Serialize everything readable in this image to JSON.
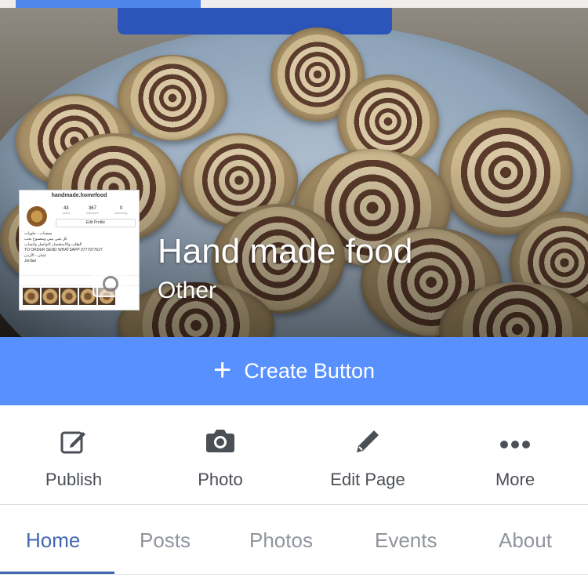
{
  "profile_card": {
    "username": "handmade.homefood",
    "stats": [
      {
        "value": "43",
        "label": "posts"
      },
      {
        "value": "367",
        "label": "followers"
      },
      {
        "value": "0",
        "label": "following"
      }
    ],
    "edit_label": "Edit Profile",
    "bio_lines": [
      "معجنات - حلويات",
      "كل شي بيتي ومصنوع بحب",
      "الطلب والاستفسار التواصل واتساب",
      "TO ORDER SEND WHATSAPP 0777977627",
      "عمان - الأردن",
      "Jordan"
    ]
  },
  "page": {
    "name": "Hand made food",
    "category": "Other"
  },
  "create_button": {
    "label": "Create Button"
  },
  "actions": [
    {
      "label": "Publish",
      "icon": "edit-icon"
    },
    {
      "label": "Photo",
      "icon": "camera-icon"
    },
    {
      "label": "Edit Page",
      "icon": "pencil-icon"
    },
    {
      "label": "More",
      "icon": "more-dots-icon"
    }
  ],
  "tabs": [
    {
      "label": "Home",
      "active": true
    },
    {
      "label": "Posts",
      "active": false
    },
    {
      "label": "Photos",
      "active": false
    },
    {
      "label": "Events",
      "active": false
    },
    {
      "label": "About",
      "active": false
    }
  ],
  "colors": {
    "brand_blue": "#5890ff",
    "tab_active": "#4267b2",
    "tab_inactive": "#90949c",
    "action_text": "#4b4f56"
  }
}
